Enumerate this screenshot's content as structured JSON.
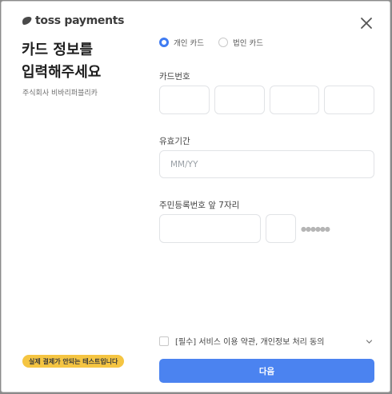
{
  "brand": {
    "logo_text": "toss payments"
  },
  "title": {
    "line1": "카드 정보를",
    "line2": "입력해주세요"
  },
  "merchant": "주식회사 비바리퍼블리카",
  "card_type": {
    "options": [
      {
        "label": "개인 카드",
        "selected": true
      },
      {
        "label": "법인 카드",
        "selected": false
      }
    ]
  },
  "card_number": {
    "label": "카드번호"
  },
  "expiry": {
    "label": "유효기간",
    "placeholder": "MM/YY"
  },
  "resident": {
    "label": "주민등록번호 앞 7자리",
    "masked": "●●●●●●"
  },
  "agreement": {
    "text": "[필수] 서비스 이용 약관, 개인정보 처리 동의"
  },
  "test_badge": "실제 결제가 안되는 테스트입니다",
  "next_button": "다음",
  "colors": {
    "primary": "#4b83f0",
    "badge": "#f5c542"
  }
}
